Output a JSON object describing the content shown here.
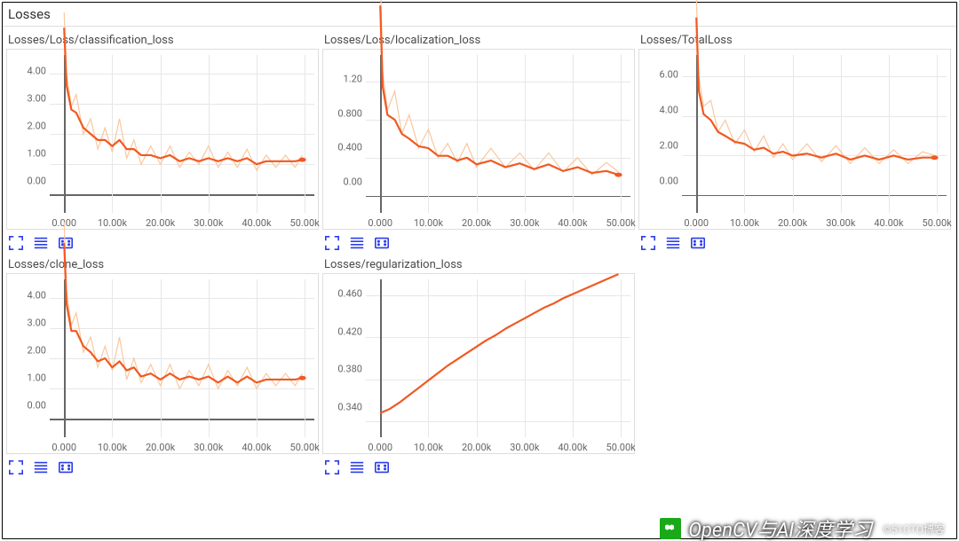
{
  "panel": {
    "title": "Losses"
  },
  "watermark": {
    "text": "OpenCV与AI深度学习",
    "subtext": "©51CTO博客"
  },
  "colors": {
    "raw": "#f8c8a0",
    "smooth": "#f05a22",
    "grid": "#e7e7e7",
    "axis_zero": "#666",
    "tool_icon": "#2c3ee8"
  },
  "xaxis_ticks": [
    {
      "v": 0,
      "label": "0.000"
    },
    {
      "v": 10000,
      "label": "10.00k"
    },
    {
      "v": 20000,
      "label": "20.00k"
    },
    {
      "v": 30000,
      "label": "30.00k"
    },
    {
      "v": 40000,
      "label": "40.00k"
    },
    {
      "v": 50000,
      "label": "50.00k"
    }
  ],
  "chart_data": [
    {
      "id": "classification_loss",
      "title": "Losses/Loss/classification_loss",
      "type": "line",
      "xlim": [
        -3000,
        52000
      ],
      "ylim": [
        -0.6,
        4.6
      ],
      "yticks": [
        {
          "v": 0,
          "label": "0.00"
        },
        {
          "v": 1,
          "label": "1.00"
        },
        {
          "v": 2,
          "label": "2.00"
        },
        {
          "v": 3,
          "label": "3.00"
        },
        {
          "v": 4,
          "label": "4.00"
        }
      ],
      "series": [
        {
          "name": "raw",
          "x": [
            0,
            500,
            1500,
            2500,
            4000,
            5500,
            7000,
            8500,
            10000,
            11500,
            13000,
            14500,
            16000,
            18000,
            20000,
            22000,
            24000,
            26000,
            28000,
            30000,
            32000,
            34000,
            36000,
            38000,
            40000,
            42000,
            44000,
            46000,
            48000,
            49500
          ],
          "values": [
            6.0,
            4.0,
            2.9,
            3.3,
            2.0,
            2.5,
            1.5,
            2.2,
            1.4,
            2.5,
            1.2,
            1.8,
            1.0,
            1.6,
            1.0,
            1.6,
            0.9,
            1.4,
            1.0,
            1.6,
            0.9,
            1.4,
            0.9,
            1.5,
            0.8,
            1.3,
            0.9,
            1.3,
            0.9,
            1.3
          ]
        },
        {
          "name": "smoothed",
          "x": [
            0,
            500,
            1500,
            2500,
            4000,
            5500,
            7000,
            8500,
            10000,
            11500,
            13000,
            14500,
            16000,
            18000,
            20000,
            22000,
            24000,
            26000,
            28000,
            30000,
            32000,
            34000,
            36000,
            38000,
            40000,
            42000,
            44000,
            46000,
            48000,
            49500
          ],
          "values": [
            5.5,
            3.6,
            2.8,
            2.7,
            2.2,
            2.0,
            1.8,
            1.8,
            1.6,
            1.8,
            1.5,
            1.5,
            1.3,
            1.3,
            1.2,
            1.3,
            1.1,
            1.2,
            1.1,
            1.2,
            1.1,
            1.2,
            1.1,
            1.2,
            1.0,
            1.1,
            1.1,
            1.1,
            1.1,
            1.15
          ]
        }
      ],
      "end_point": {
        "x": 49500,
        "y": 1.15
      }
    },
    {
      "id": "localization_loss",
      "title": "Losses/Loss/localization_loss",
      "type": "line",
      "xlim": [
        -3000,
        52000
      ],
      "ylim": [
        -0.18,
        1.48
      ],
      "yticks": [
        {
          "v": 0,
          "label": "0.00"
        },
        {
          "v": 0.4,
          "label": "0.400"
        },
        {
          "v": 0.8,
          "label": "0.800"
        },
        {
          "v": 1.2,
          "label": "1.20"
        }
      ],
      "series": [
        {
          "name": "raw",
          "x": [
            0,
            500,
            1500,
            3000,
            4500,
            6000,
            8000,
            10000,
            12000,
            14000,
            16000,
            18000,
            20000,
            23000,
            26000,
            29000,
            32000,
            35000,
            38000,
            41000,
            44000,
            47000,
            49500
          ],
          "values": [
            2.4,
            1.3,
            0.9,
            1.1,
            0.65,
            0.85,
            0.5,
            0.7,
            0.4,
            0.55,
            0.35,
            0.55,
            0.3,
            0.5,
            0.3,
            0.45,
            0.27,
            0.45,
            0.25,
            0.4,
            0.22,
            0.35,
            0.25
          ]
        },
        {
          "name": "smoothed",
          "x": [
            0,
            500,
            1500,
            3000,
            4500,
            6000,
            8000,
            10000,
            12000,
            14000,
            16000,
            18000,
            20000,
            23000,
            26000,
            29000,
            32000,
            35000,
            38000,
            41000,
            44000,
            47000,
            49500
          ],
          "values": [
            2.0,
            1.15,
            0.85,
            0.8,
            0.65,
            0.6,
            0.52,
            0.5,
            0.42,
            0.42,
            0.37,
            0.4,
            0.33,
            0.37,
            0.3,
            0.34,
            0.28,
            0.33,
            0.26,
            0.3,
            0.24,
            0.26,
            0.22
          ]
        }
      ],
      "end_point": {
        "x": 49500,
        "y": 0.22
      }
    },
    {
      "id": "total_loss",
      "title": "Losses/TotalLoss",
      "type": "line",
      "xlim": [
        -3000,
        52000
      ],
      "ylim": [
        -0.9,
        7.1
      ],
      "yticks": [
        {
          "v": 0,
          "label": "0.00"
        },
        {
          "v": 2,
          "label": "2.00"
        },
        {
          "v": 4,
          "label": "4.00"
        },
        {
          "v": 6,
          "label": "6.00"
        }
      ],
      "series": [
        {
          "name": "raw",
          "x": [
            0,
            500,
            1500,
            3000,
            4500,
            6000,
            8000,
            10000,
            12000,
            14000,
            16000,
            18000,
            20000,
            23000,
            26000,
            29000,
            32000,
            35000,
            38000,
            41000,
            44000,
            47000,
            49500
          ],
          "values": [
            10,
            6.0,
            4.5,
            4.8,
            3.2,
            3.8,
            2.6,
            3.3,
            2.2,
            3.0,
            1.9,
            2.6,
            1.8,
            2.6,
            1.7,
            2.5,
            1.6,
            2.4,
            1.6,
            2.3,
            1.6,
            2.2,
            2.0
          ]
        },
        {
          "name": "smoothed",
          "x": [
            0,
            500,
            1500,
            3000,
            4500,
            6000,
            8000,
            10000,
            12000,
            14000,
            16000,
            18000,
            20000,
            23000,
            26000,
            29000,
            32000,
            35000,
            38000,
            41000,
            44000,
            47000,
            49500
          ],
          "values": [
            9,
            5.3,
            4.1,
            3.8,
            3.2,
            3.0,
            2.7,
            2.6,
            2.3,
            2.4,
            2.1,
            2.2,
            2.0,
            2.1,
            1.9,
            2.1,
            1.8,
            2.0,
            1.8,
            2.0,
            1.8,
            1.9,
            1.9
          ]
        }
      ],
      "end_point": {
        "x": 49500,
        "y": 1.9
      }
    },
    {
      "id": "clone_loss",
      "title": "Losses/clone_loss",
      "type": "line",
      "xlim": [
        -3000,
        52000
      ],
      "ylim": [
        -0.6,
        4.6
      ],
      "yticks": [
        {
          "v": 0,
          "label": "0.00"
        },
        {
          "v": 1,
          "label": "1.00"
        },
        {
          "v": 2,
          "label": "2.00"
        },
        {
          "v": 3,
          "label": "3.00"
        },
        {
          "v": 4,
          "label": "4.00"
        }
      ],
      "series": [
        {
          "name": "raw",
          "x": [
            0,
            500,
            1500,
            2500,
            4000,
            5500,
            7000,
            8500,
            10000,
            11500,
            13000,
            14500,
            16000,
            18000,
            20000,
            22000,
            24000,
            26000,
            28000,
            30000,
            32000,
            34000,
            36000,
            38000,
            40000,
            42000,
            44000,
            46000,
            48000,
            49500
          ],
          "values": [
            6.5,
            4.2,
            3.1,
            3.5,
            2.2,
            2.7,
            1.7,
            2.4,
            1.6,
            2.7,
            1.3,
            2.0,
            1.2,
            1.8,
            1.1,
            1.8,
            1.0,
            1.6,
            1.1,
            1.8,
            1.0,
            1.6,
            1.1,
            1.7,
            1.0,
            1.5,
            1.1,
            1.5,
            1.1,
            1.5
          ]
        },
        {
          "name": "smoothed",
          "x": [
            0,
            500,
            1500,
            2500,
            4000,
            5500,
            7000,
            8500,
            10000,
            11500,
            13000,
            14500,
            16000,
            18000,
            20000,
            22000,
            24000,
            26000,
            28000,
            30000,
            32000,
            34000,
            36000,
            38000,
            40000,
            42000,
            44000,
            46000,
            48000,
            49500
          ],
          "values": [
            5.8,
            3.8,
            2.9,
            2.9,
            2.4,
            2.2,
            1.9,
            2.0,
            1.7,
            1.9,
            1.6,
            1.7,
            1.4,
            1.5,
            1.3,
            1.5,
            1.3,
            1.4,
            1.3,
            1.4,
            1.2,
            1.4,
            1.2,
            1.4,
            1.2,
            1.3,
            1.3,
            1.3,
            1.3,
            1.35
          ]
        }
      ],
      "end_point": {
        "x": 49500,
        "y": 1.35
      }
    },
    {
      "id": "regularization_loss",
      "title": "Losses/regularization_loss",
      "type": "line",
      "xlim": [
        -3000,
        52000
      ],
      "ylim": [
        0.325,
        0.475
      ],
      "yticks": [
        {
          "v": 0.34,
          "label": "0.340"
        },
        {
          "v": 0.38,
          "label": "0.380"
        },
        {
          "v": 0.42,
          "label": "0.420"
        },
        {
          "v": 0.46,
          "label": "0.460"
        }
      ],
      "series": [
        {
          "name": "raw",
          "x": [
            0,
            2000,
            4000,
            6000,
            8000,
            10000,
            12000,
            14000,
            16000,
            18000,
            20000,
            22000,
            24000,
            26000,
            28000,
            30000,
            32000,
            34000,
            36000,
            38000,
            40000,
            42000,
            44000,
            46000,
            48000,
            49500
          ],
          "values": [
            0.348,
            0.352,
            0.358,
            0.365,
            0.372,
            0.379,
            0.386,
            0.393,
            0.399,
            0.405,
            0.411,
            0.417,
            0.422,
            0.428,
            0.433,
            0.438,
            0.443,
            0.448,
            0.452,
            0.457,
            0.461,
            0.465,
            0.469,
            0.473,
            0.477,
            0.48
          ]
        },
        {
          "name": "smoothed",
          "x": [
            0,
            2000,
            4000,
            6000,
            8000,
            10000,
            12000,
            14000,
            16000,
            18000,
            20000,
            22000,
            24000,
            26000,
            28000,
            30000,
            32000,
            34000,
            36000,
            38000,
            40000,
            42000,
            44000,
            46000,
            48000,
            49500
          ],
          "values": [
            0.348,
            0.352,
            0.358,
            0.365,
            0.372,
            0.379,
            0.386,
            0.393,
            0.399,
            0.405,
            0.411,
            0.417,
            0.422,
            0.428,
            0.433,
            0.438,
            0.443,
            0.448,
            0.452,
            0.457,
            0.461,
            0.465,
            0.469,
            0.473,
            0.477,
            0.48
          ]
        }
      ]
    }
  ],
  "tools": [
    {
      "id": "expand",
      "label": "expand-icon"
    },
    {
      "id": "list",
      "label": "list-icon"
    },
    {
      "id": "region",
      "label": "region-select-icon"
    }
  ]
}
